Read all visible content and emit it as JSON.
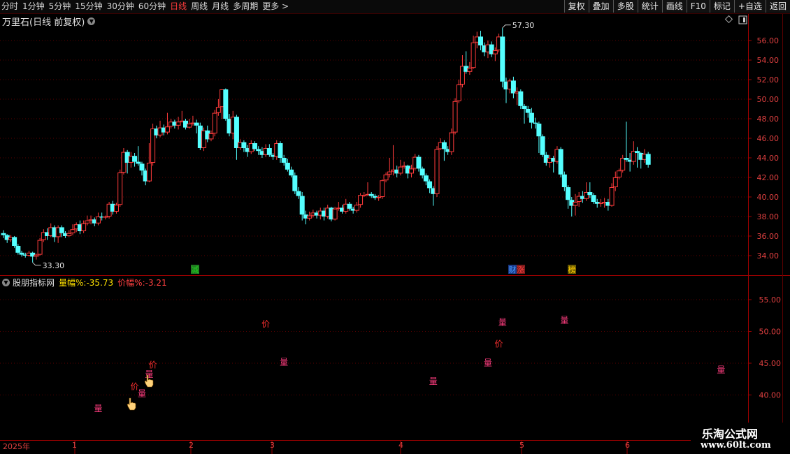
{
  "toolbar": {
    "periods": [
      "分时",
      "1分钟",
      "5分钟",
      "15分钟",
      "30分钟",
      "60分钟",
      "日线",
      "周线",
      "月线",
      "多周期",
      "更多 >"
    ],
    "active_period": "日线",
    "actions": [
      "复权",
      "叠加",
      "多股",
      "统计",
      "画线",
      "F10",
      "标记",
      "+自选",
      "返回"
    ]
  },
  "main_chart": {
    "title": "万里石(日线 前复权)",
    "high_label": "57.30",
    "low_label": "33.30",
    "price_ticks": [
      "56.00",
      "54.00",
      "52.00",
      "50.00",
      "48.00",
      "46.00",
      "44.00",
      "42.00",
      "40.00",
      "38.00",
      "36.00",
      "34.00"
    ],
    "markers": [
      {
        "text": "减",
        "color": "#22cc22"
      },
      {
        "text": "财",
        "color": "#4aa0ff"
      },
      {
        "text": "涨",
        "color": "#ff4040"
      },
      {
        "text": "榜",
        "color": "#ffcc00"
      }
    ],
    "colors": {
      "up": "#ff3b3b",
      "down": "#54ffff",
      "grid": "#7a0000"
    }
  },
  "chart_data": {
    "type": "candlestick",
    "ylim": [
      33,
      57.3
    ],
    "high": 57.3,
    "low": 33.3,
    "candles": [
      [
        36.3,
        36.1,
        36.6,
        35.8
      ],
      [
        36.1,
        35.6,
        36.2,
        35.3
      ],
      [
        35.6,
        35.9,
        36.1,
        35.4
      ],
      [
        35.9,
        35.0,
        36.0,
        34.8
      ],
      [
        35.0,
        34.3,
        35.2,
        34.1
      ],
      [
        34.3,
        34.1,
        34.5,
        33.9
      ],
      [
        34.1,
        34.0,
        34.3,
        33.8
      ],
      [
        34.0,
        34.3,
        34.5,
        33.9
      ],
      [
        34.3,
        33.9,
        34.4,
        33.3
      ],
      [
        33.9,
        34.1,
        34.2,
        33.6
      ],
      [
        34.1,
        35.6,
        35.8,
        34.0
      ],
      [
        35.6,
        36.4,
        36.7,
        35.4
      ],
      [
        36.4,
        36.0,
        36.8,
        35.6
      ],
      [
        36.0,
        36.9,
        37.3,
        35.9
      ],
      [
        36.9,
        35.9,
        37.1,
        35.4
      ],
      [
        35.9,
        36.9,
        37.1,
        35.3
      ],
      [
        36.9,
        36.3,
        37.1,
        35.9
      ],
      [
        36.3,
        36.0,
        36.5,
        35.8
      ],
      [
        36.0,
        36.3,
        36.6,
        35.9
      ],
      [
        36.3,
        36.7,
        37.2,
        36.1
      ],
      [
        36.7,
        37.2,
        37.4,
        36.4
      ],
      [
        37.2,
        36.5,
        37.6,
        36.2
      ],
      [
        36.5,
        37.3,
        37.6,
        36.3
      ],
      [
        37.3,
        37.6,
        38.1,
        37.1
      ],
      [
        37.6,
        37.7,
        38.1,
        37.2
      ],
      [
        37.7,
        37.3,
        37.9,
        37.0
      ],
      [
        37.3,
        38.0,
        38.4,
        37.1
      ],
      [
        38.0,
        37.9,
        38.4,
        37.6
      ],
      [
        37.9,
        38.0,
        38.1,
        37.7
      ],
      [
        38.0,
        39.3,
        39.5,
        37.8
      ],
      [
        39.3,
        38.5,
        39.6,
        38.2
      ],
      [
        38.5,
        39.2,
        39.4,
        38.3
      ],
      [
        39.2,
        42.5,
        42.8,
        39.0
      ],
      [
        42.5,
        44.6,
        45.0,
        42.3
      ],
      [
        44.6,
        43.5,
        44.8,
        42.4
      ],
      [
        43.5,
        44.2,
        44.6,
        43.0
      ],
      [
        44.2,
        43.6,
        44.5,
        43.1
      ],
      [
        43.6,
        43.4,
        45.2,
        43.2
      ],
      [
        43.4,
        42.7,
        43.6,
        42.2
      ],
      [
        42.7,
        41.6,
        42.9,
        41.2
      ],
      [
        41.6,
        43.5,
        45.5,
        41.5
      ],
      [
        43.5,
        47.0,
        47.5,
        43.2
      ],
      [
        47.0,
        46.3,
        47.3,
        46.0
      ],
      [
        46.3,
        47.1,
        47.8,
        46.1
      ],
      [
        47.1,
        46.6,
        47.4,
        46.3
      ],
      [
        46.6,
        47.2,
        48.6,
        46.4
      ],
      [
        47.2,
        47.7,
        48.0,
        47.0
      ],
      [
        47.7,
        47.3,
        47.9,
        47.0
      ],
      [
        47.3,
        47.7,
        48.2,
        46.9
      ],
      [
        47.7,
        47.8,
        48.8,
        47.6
      ],
      [
        47.8,
        47.1,
        48.0,
        46.9
      ],
      [
        47.1,
        47.5,
        48.0,
        47.0
      ],
      [
        47.5,
        47.6,
        48.3,
        47.3
      ],
      [
        47.6,
        47.3,
        47.9,
        46.5
      ],
      [
        47.3,
        45.0,
        47.6,
        44.8
      ],
      [
        45.0,
        46.8,
        47.1,
        44.7
      ],
      [
        46.8,
        45.9,
        47.3,
        45.6
      ],
      [
        45.9,
        46.5,
        46.8,
        45.7
      ],
      [
        46.5,
        48.6,
        48.9,
        46.2
      ],
      [
        48.6,
        49.2,
        50.0,
        48.3
      ],
      [
        49.2,
        51.0,
        51.0,
        48.0
      ],
      [
        51.0,
        48.0,
        51.1,
        47.8
      ],
      [
        48.0,
        46.5,
        48.5,
        46.2
      ],
      [
        46.5,
        48.2,
        48.8,
        45.9
      ],
      [
        48.2,
        45.0,
        48.4,
        43.8
      ],
      [
        45.0,
        45.6,
        45.9,
        44.8
      ],
      [
        45.6,
        45.0,
        45.8,
        44.6
      ],
      [
        45.0,
        44.6,
        45.3,
        44.1
      ],
      [
        44.6,
        45.5,
        45.8,
        44.4
      ],
      [
        45.5,
        44.9,
        45.7,
        44.7
      ],
      [
        44.9,
        44.7,
        45.2,
        44.3
      ],
      [
        44.7,
        44.3,
        45.1,
        44.0
      ],
      [
        44.3,
        45.0,
        45.4,
        44.1
      ],
      [
        45.0,
        44.3,
        45.4,
        44.1
      ],
      [
        44.3,
        44.1,
        44.5,
        43.8
      ],
      [
        44.1,
        45.5,
        45.8,
        43.8
      ],
      [
        45.5,
        44.0,
        45.7,
        43.5
      ],
      [
        44.0,
        43.5,
        44.3,
        43.2
      ],
      [
        43.5,
        42.8,
        43.9,
        42.6
      ],
      [
        42.8,
        42.2,
        43.1,
        42.0
      ],
      [
        42.2,
        40.6,
        42.5,
        40.3
      ],
      [
        40.6,
        40.1,
        41.0,
        39.8
      ],
      [
        40.1,
        38.2,
        40.5,
        37.6
      ],
      [
        38.2,
        37.8,
        38.6,
        37.2
      ],
      [
        37.8,
        38.1,
        38.5,
        37.6
      ],
      [
        38.1,
        38.4,
        38.7,
        37.9
      ],
      [
        38.4,
        38.1,
        38.6,
        37.8
      ],
      [
        38.1,
        38.6,
        38.9,
        37.7
      ],
      [
        38.6,
        38.0,
        38.9,
        37.6
      ],
      [
        38.0,
        38.9,
        39.2,
        37.8
      ],
      [
        38.9,
        37.7,
        39.0,
        37.5
      ],
      [
        37.7,
        38.8,
        39.0,
        37.6
      ],
      [
        38.8,
        38.9,
        39.5,
        38.6
      ],
      [
        38.9,
        38.5,
        39.2,
        38.3
      ],
      [
        38.5,
        39.3,
        39.8,
        38.3
      ],
      [
        39.3,
        38.8,
        39.5,
        38.6
      ],
      [
        38.8,
        38.6,
        39.0,
        38.3
      ],
      [
        38.6,
        39.2,
        39.5,
        38.4
      ],
      [
        39.2,
        40.2,
        40.4,
        38.9
      ],
      [
        40.2,
        40.2,
        40.5,
        40.0
      ],
      [
        40.2,
        40.3,
        41.5,
        40.1
      ],
      [
        40.3,
        40.1,
        40.5,
        39.9
      ],
      [
        40.1,
        39.9,
        40.3,
        39.7
      ],
      [
        39.9,
        40.0,
        40.2,
        39.6
      ],
      [
        40.0,
        41.7,
        41.8,
        39.8
      ],
      [
        41.7,
        42.3,
        42.5,
        41.5
      ],
      [
        42.3,
        42.6,
        44.0,
        42.0
      ],
      [
        42.6,
        42.8,
        45.3,
        42.2
      ],
      [
        42.8,
        42.4,
        43.2,
        42.0
      ],
      [
        42.4,
        43.1,
        43.8,
        42.2
      ],
      [
        43.1,
        43.2,
        43.6,
        42.9
      ],
      [
        43.2,
        42.4,
        43.3,
        41.9
      ],
      [
        42.4,
        42.9,
        43.3,
        42.0
      ],
      [
        42.9,
        44.1,
        44.4,
        42.7
      ],
      [
        44.1,
        42.9,
        44.3,
        42.6
      ],
      [
        42.9,
        42.2,
        43.1,
        41.9
      ],
      [
        42.2,
        41.6,
        42.4,
        41.2
      ],
      [
        41.6,
        40.9,
        41.8,
        40.4
      ],
      [
        40.9,
        40.3,
        41.1,
        39.1
      ],
      [
        40.3,
        44.9,
        45.2,
        40.0
      ],
      [
        44.9,
        45.6,
        46.0,
        44.8
      ],
      [
        45.6,
        44.9,
        45.8,
        43.7
      ],
      [
        44.9,
        44.6,
        45.2,
        44.3
      ],
      [
        44.6,
        46.6,
        47.0,
        44.3
      ],
      [
        46.6,
        49.8,
        50.1,
        46.4
      ],
      [
        49.8,
        51.5,
        52.0,
        49.6
      ],
      [
        51.5,
        53.4,
        54.5,
        51.2
      ],
      [
        53.4,
        52.8,
        54.9,
        52.6
      ],
      [
        52.8,
        53.2,
        53.8,
        52.5
      ],
      [
        53.2,
        55.8,
        56.5,
        53.1
      ],
      [
        55.8,
        56.4,
        56.9,
        55.2
      ],
      [
        56.4,
        55.5,
        57.0,
        55.0
      ],
      [
        55.5,
        54.8,
        55.8,
        54.4
      ],
      [
        54.8,
        55.6,
        56.0,
        54.2
      ],
      [
        55.6,
        54.6,
        55.9,
        54.3
      ],
      [
        54.6,
        55.0,
        55.3,
        53.9
      ],
      [
        55.0,
        56.4,
        56.7,
        54.8
      ],
      [
        56.4,
        51.8,
        57.3,
        51.2
      ],
      [
        51.8,
        51.0,
        52.2,
        49.6
      ],
      [
        51.0,
        51.9,
        52.1,
        50.6
      ],
      [
        51.9,
        50.6,
        52.3,
        50.1
      ],
      [
        50.6,
        50.8,
        51.2,
        49.4
      ],
      [
        50.8,
        49.3,
        51.0,
        49.0
      ],
      [
        49.3,
        49.0,
        49.5,
        47.5
      ],
      [
        49.0,
        48.6,
        49.3,
        48.1
      ],
      [
        48.6,
        47.6,
        49.1,
        47.0
      ],
      [
        47.6,
        47.5,
        48.1,
        47.0
      ],
      [
        47.5,
        46.2,
        47.7,
        44.5
      ],
      [
        46.2,
        44.3,
        46.4,
        44.1
      ],
      [
        44.3,
        43.5,
        44.6,
        43.2
      ],
      [
        43.5,
        44.0,
        44.3,
        43.0
      ],
      [
        44.0,
        43.6,
        44.2,
        42.5
      ],
      [
        43.6,
        44.9,
        45.2,
        43.4
      ],
      [
        44.9,
        42.3,
        45.1,
        42.0
      ],
      [
        42.3,
        41.0,
        42.6,
        40.6
      ],
      [
        41.0,
        39.7,
        41.2,
        38.8
      ],
      [
        39.7,
        39.1,
        40.0,
        38.0
      ],
      [
        39.1,
        39.5,
        40.3,
        38.1
      ],
      [
        39.5,
        40.1,
        40.5,
        39.0
      ],
      [
        40.1,
        39.8,
        40.6,
        39.4
      ],
      [
        39.8,
        40.5,
        41.5,
        39.6
      ],
      [
        40.5,
        40.2,
        41.5,
        39.9
      ],
      [
        40.2,
        39.5,
        40.4,
        39.3
      ],
      [
        39.5,
        39.3,
        39.8,
        38.9
      ],
      [
        39.3,
        39.4,
        39.8,
        39.0
      ],
      [
        39.4,
        39.5,
        39.9,
        38.9
      ],
      [
        39.5,
        39.1,
        39.8,
        38.6
      ],
      [
        39.1,
        41.0,
        41.4,
        39.0
      ],
      [
        41.0,
        42.0,
        42.6,
        40.6
      ],
      [
        42.0,
        42.7,
        42.9,
        41.8
      ],
      [
        42.7,
        44.0,
        44.3,
        42.5
      ],
      [
        44.0,
        43.8,
        47.7,
        43.6
      ],
      [
        43.8,
        43.6,
        44.5,
        42.6
      ],
      [
        43.6,
        44.7,
        45.7,
        43.3
      ],
      [
        44.7,
        44.5,
        45.1,
        43.0
      ],
      [
        44.5,
        43.8,
        44.6,
        42.9
      ],
      [
        43.8,
        44.4,
        44.9,
        43.5
      ],
      [
        44.4,
        43.3,
        44.6,
        43.0
      ]
    ],
    "indicator": {
      "name": "股朋指标网",
      "series": [
        {
          "name": "量幅%",
          "value": "-35.73",
          "color": "#ffe100"
        },
        {
          "name": "价幅%",
          "value": "-3.21",
          "color": "#ff4040"
        }
      ],
      "ticks": [
        "55.00",
        "50.00",
        "45.00",
        "40.00"
      ],
      "ylim": [
        35.5,
        58
      ],
      "points": [
        {
          "label": "量",
          "date_index": 26,
          "y": 37.4
        },
        {
          "label": "量",
          "date_index": 38,
          "y": 39.8
        },
        {
          "label": "价",
          "date_index": 36,
          "y": 40.9
        },
        {
          "label": "量",
          "date_index": 40,
          "y": 42.8
        },
        {
          "label": "价",
          "date_index": 41,
          "y": 44.3
        },
        {
          "label": "价",
          "date_index": 72,
          "y": 50.7
        },
        {
          "label": "量",
          "date_index": 77,
          "y": 44.7
        },
        {
          "label": "量",
          "date_index": 118,
          "y": 41.7
        },
        {
          "label": "量",
          "date_index": 133,
          "y": 44.6
        },
        {
          "label": "价",
          "date_index": 136,
          "y": 47.6
        },
        {
          "label": "量",
          "date_index": 137,
          "y": 51.0
        },
        {
          "label": "量",
          "date_index": 154,
          "y": 51.3
        },
        {
          "label": "量",
          "date_index": 197,
          "y": 43.5
        }
      ]
    },
    "x_axis": [
      "2025年",
      "1",
      "2",
      "3",
      "4",
      "5",
      "6"
    ]
  },
  "watermark": {
    "line1": "乐淘公式网",
    "line2": "www.60lt.com"
  }
}
